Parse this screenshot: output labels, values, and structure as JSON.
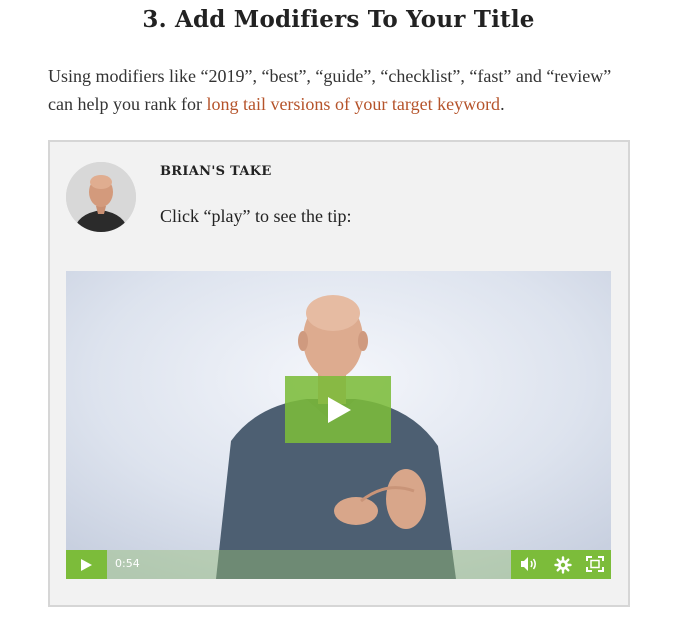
{
  "heading": "3. Add Modifiers To Your Title",
  "intro": {
    "text": "Using modifiers like “2019”, “best”, “guide”, “checklist”, “fast” and “review” can help you rank for ",
    "link": "long tail versions of your target keyword",
    "end": "."
  },
  "take": {
    "title": "BRIAN'S TAKE",
    "text": "Click “play” to see the tip:"
  },
  "video": {
    "time": "0:54"
  },
  "colors": {
    "accent_green": "#7cbc3a",
    "link": "#b5532a",
    "box_bg": "#f2f2f2"
  },
  "icons": [
    "avatar-photo",
    "play-icon",
    "volume-icon",
    "gear-icon",
    "fullscreen-icon"
  ]
}
